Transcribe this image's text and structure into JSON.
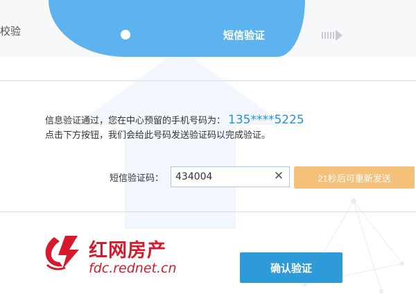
{
  "steps": {
    "prev_label": "校验",
    "active_label": "短信验证"
  },
  "info": {
    "line1_prefix": "信息验证通过，您在中心预留的手机号码为：",
    "phone": "135****5225",
    "line2": "点击下方按钮，我们会给此号码发送验证码以完成验证。"
  },
  "sms": {
    "label": "短信验证码：",
    "value": "434004",
    "clear_symbol": "✕",
    "resend_label": "21秒后可重新发送"
  },
  "confirm_label": "确认验证",
  "logo": {
    "name_cn": "红网房产",
    "url": "fdc.rednet.cn"
  },
  "colors": {
    "step_active": "#5db3ee",
    "phone": "#2a8fd8",
    "resend_bg": "#f5c07a",
    "confirm_bg": "#2f9ad8",
    "logo_red": "#d7192b"
  }
}
